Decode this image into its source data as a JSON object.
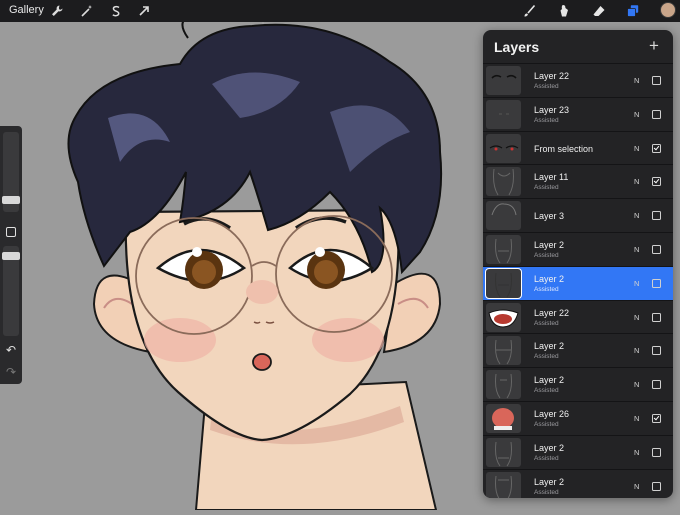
{
  "toolbar": {
    "gallery_label": "Gallery",
    "left_icons": [
      "wrench-icon",
      "magic-wand-icon",
      "selection-s-icon",
      "move-arrow-icon"
    ],
    "right_icons": [
      "brush-icon",
      "smudge-icon",
      "eraser-icon",
      "layers-icon",
      "color-swatch-icon"
    ],
    "active_color": "#c9a58a",
    "accent": "#3277f5"
  },
  "sidebar": {
    "size_slider_level": 0.36,
    "opacity_slider_level": 0.42,
    "undo_icon": "undo-icon",
    "redo_icon": "redo-icon"
  },
  "layers": {
    "title": "Layers",
    "add_icon": "plus-icon",
    "items": [
      {
        "name": "Layer 22",
        "subtitle": "Assisted",
        "blend": "N",
        "visible": false,
        "selected": false
      },
      {
        "name": "Layer 23",
        "subtitle": "Assisted",
        "blend": "N",
        "visible": false,
        "selected": false
      },
      {
        "name": "From selection",
        "subtitle": "",
        "blend": "N",
        "visible": true,
        "selected": false
      },
      {
        "name": "Layer 11",
        "subtitle": "Assisted",
        "blend": "N",
        "visible": true,
        "selected": false
      },
      {
        "name": "Layer 3",
        "subtitle": "",
        "blend": "N",
        "visible": false,
        "selected": false
      },
      {
        "name": "Layer 2",
        "subtitle": "Assisted",
        "blend": "N",
        "visible": false,
        "selected": false
      },
      {
        "name": "Layer 2",
        "subtitle": "Assisted",
        "blend": "N",
        "visible": false,
        "selected": true
      },
      {
        "name": "Layer 22",
        "subtitle": "Assisted",
        "blend": "N",
        "visible": false,
        "selected": false
      },
      {
        "name": "Layer 2",
        "subtitle": "Assisted",
        "blend": "N",
        "visible": false,
        "selected": false
      },
      {
        "name": "Layer 2",
        "subtitle": "Assisted",
        "blend": "N",
        "visible": false,
        "selected": false
      },
      {
        "name": "Layer 26",
        "subtitle": "Assisted",
        "blend": "N",
        "visible": true,
        "selected": false
      },
      {
        "name": "Layer 2",
        "subtitle": "Assisted",
        "blend": "N",
        "visible": false,
        "selected": false
      },
      {
        "name": "Layer 2",
        "subtitle": "Assisted",
        "blend": "N",
        "visible": false,
        "selected": false
      }
    ]
  }
}
